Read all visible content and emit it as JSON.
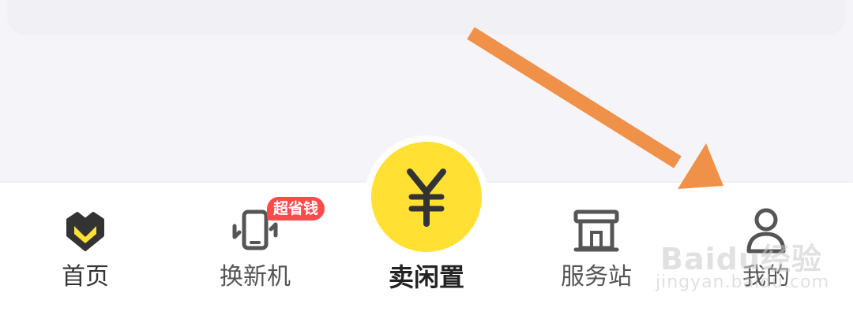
{
  "tabbar": {
    "items": [
      {
        "label": "首页",
        "icon": "home-heart-icon"
      },
      {
        "label": "换新机",
        "icon": "phone-swap-icon",
        "badge": "超省钱"
      },
      {
        "label": "卖闲置",
        "icon": "yen-icon"
      },
      {
        "label": "服务站",
        "icon": "store-icon"
      },
      {
        "label": "我的",
        "icon": "user-icon"
      }
    ]
  },
  "watermark": {
    "main": "Baidu经验",
    "sub": "jingyan.baidu.com"
  },
  "colors": {
    "accent_yellow": "#ffe033",
    "badge_red": "#ff4a4a",
    "arrow_orange": "#f0914a",
    "icon_dark": "#333333",
    "icon_gray": "#555555",
    "background": "#f5f4f8"
  }
}
